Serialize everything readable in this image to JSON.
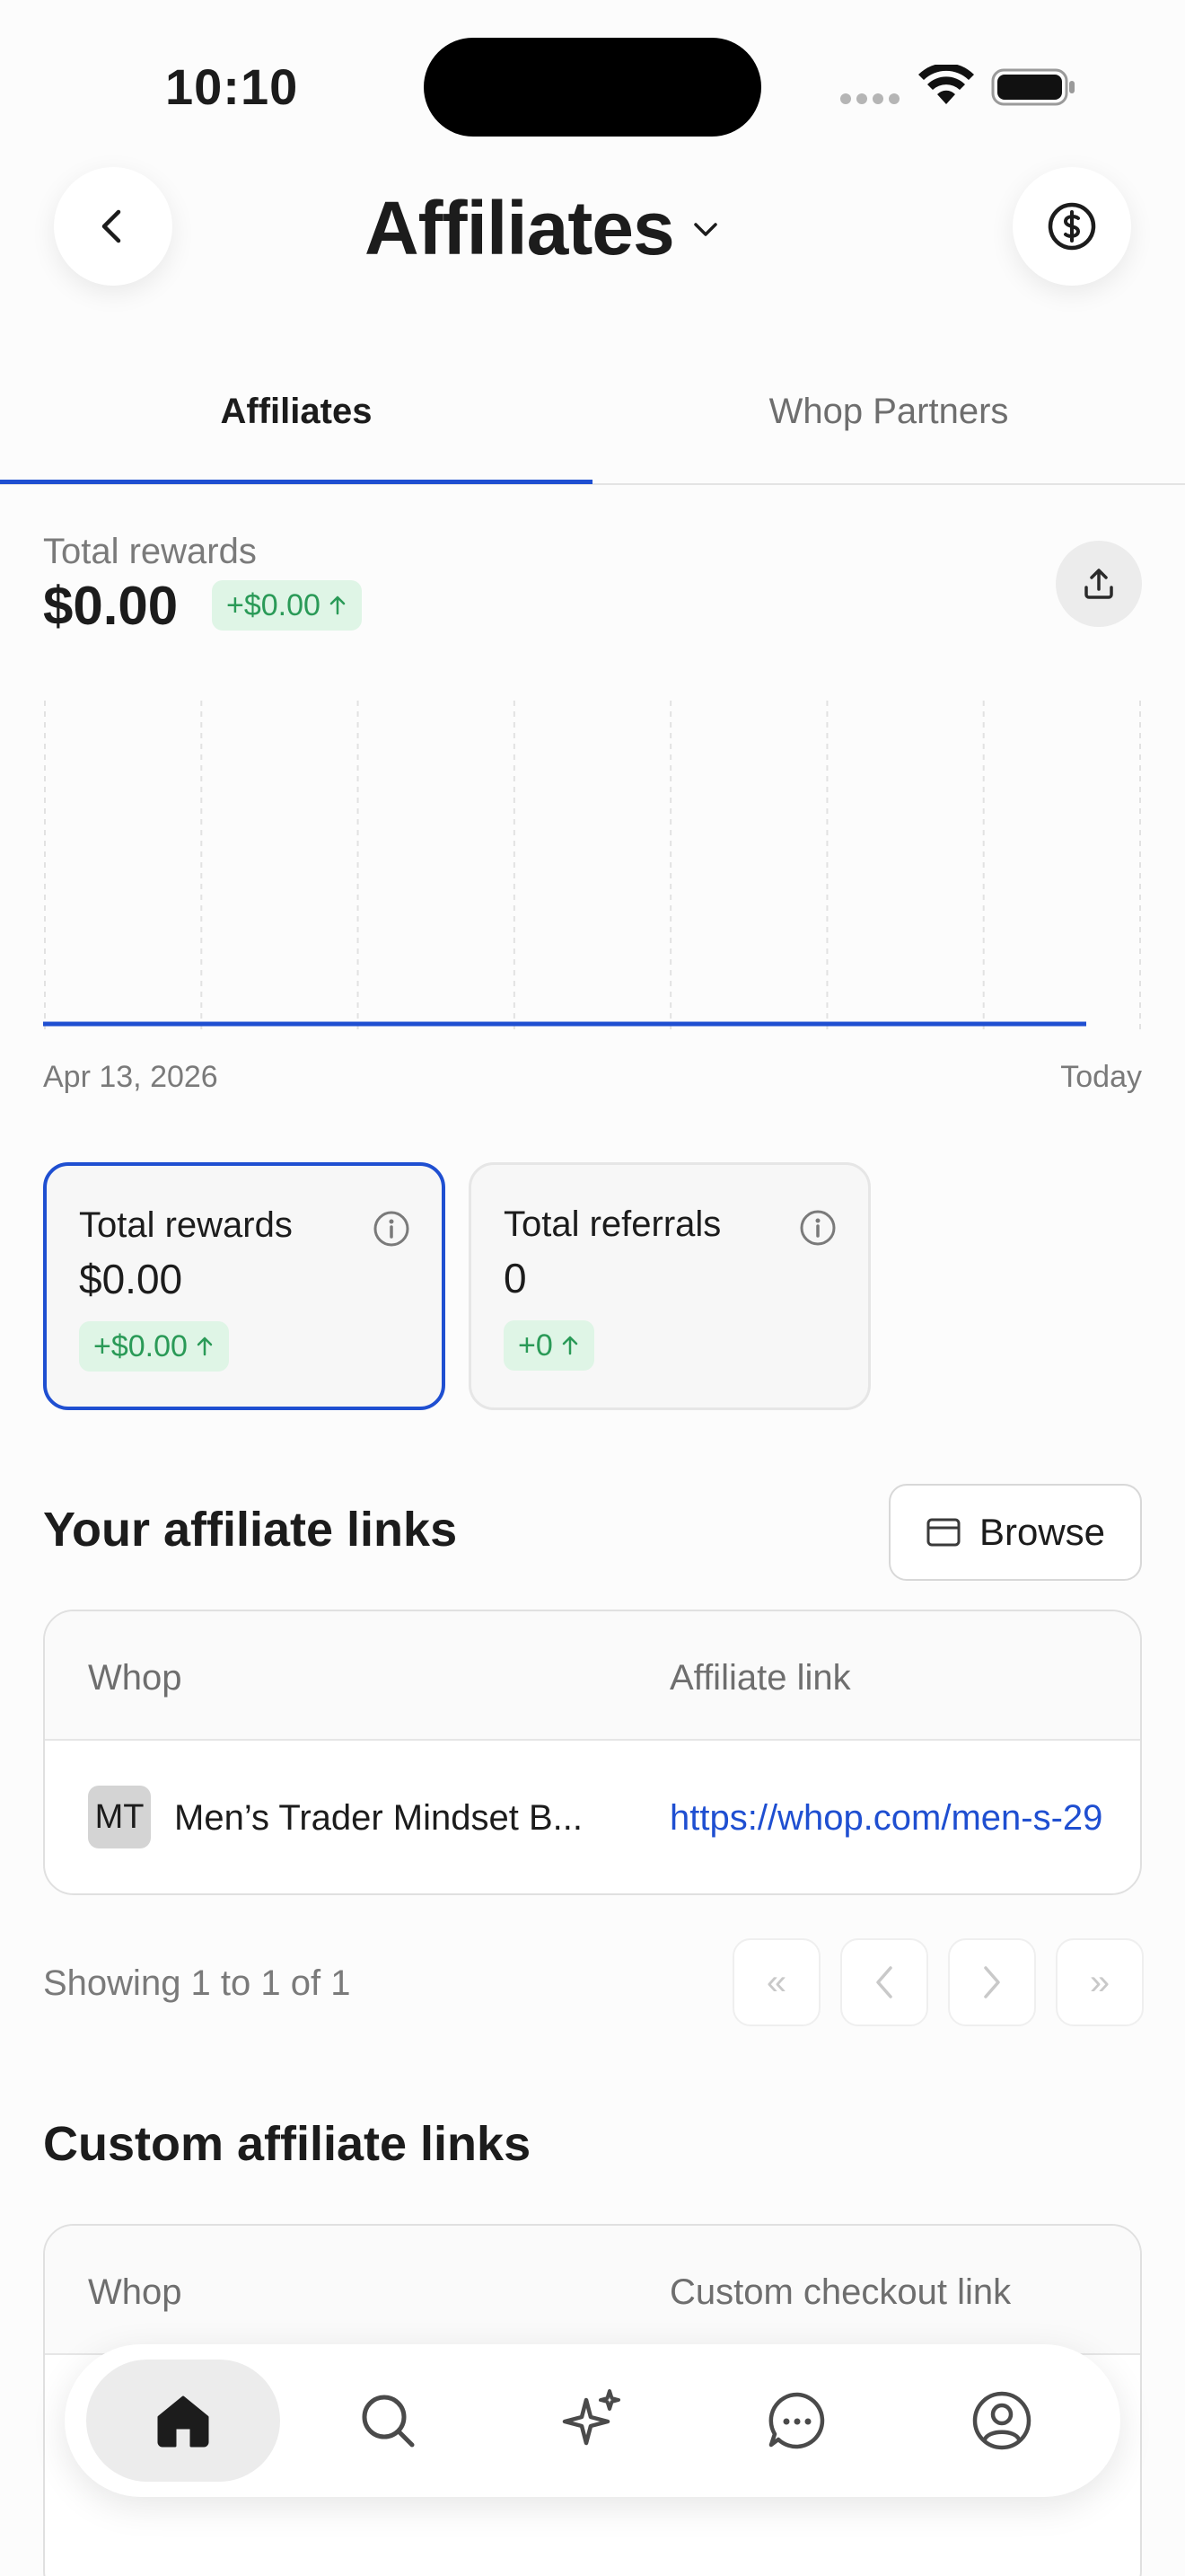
{
  "status_bar": {
    "time": "10:10"
  },
  "header": {
    "title": "Affiliates"
  },
  "tabs": [
    {
      "label": "Affiliates",
      "active": true
    },
    {
      "label": "Whop Partners",
      "active": false
    }
  ],
  "summary": {
    "label": "Total rewards",
    "value": "$0.00",
    "change": "+$0.00"
  },
  "chart": {
    "start_label": "Apr 13, 2026",
    "end_label": "Today",
    "line_color": "#1f4fd1"
  },
  "chart_data": {
    "type": "line",
    "x": [
      "Apr 13, 2026",
      "Today"
    ],
    "series": [
      {
        "values": [
          0,
          0
        ]
      }
    ]
  },
  "cards": [
    {
      "label": "Total rewards",
      "value": "$0.00",
      "change": "+$0.00",
      "selected": true
    },
    {
      "label": "Total referrals",
      "value": "0",
      "change": "+0",
      "selected": false
    }
  ],
  "affiliate_links": {
    "title": "Your affiliate links",
    "browse_label": "Browse",
    "columns": [
      "Whop",
      "Affiliate link"
    ],
    "rows": [
      {
        "initials": "MT",
        "name": "Men’s Trader Mindset B...",
        "link": "https://whop.com/men-s-29"
      }
    ],
    "showing": "Showing 1 to 1 of 1"
  },
  "custom_links": {
    "title": "Custom affiliate links",
    "columns": [
      "Whop",
      "Custom checkout link"
    ]
  },
  "pager": {
    "first": "«",
    "last": "»"
  },
  "colors": {
    "accent": "#1f4fd1",
    "positive": "#2a9a57",
    "positive_bg": "#dff5e6"
  }
}
